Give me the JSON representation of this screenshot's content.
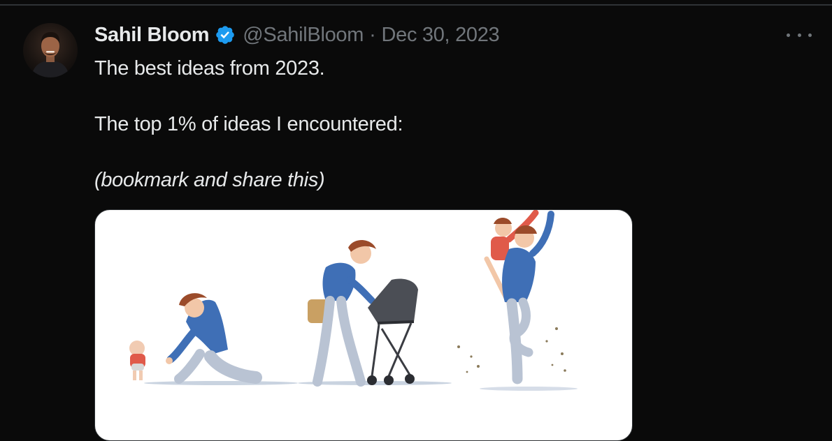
{
  "tweet": {
    "author_name": "Sahil Bloom",
    "handle": "@SahilBloom",
    "separator": "·",
    "date": "Dec 30, 2023",
    "verified": true,
    "lines": [
      "The best ideas from 2023.",
      "The top 1% of ideas I encountered:",
      "(bookmark and share this)"
    ],
    "media": {
      "description_icon": "illustration-image",
      "scenes": [
        "father-baby-first-steps",
        "father-pushing-stroller",
        "father-carrying-child"
      ]
    }
  },
  "colors": {
    "background": "#0a0a0a",
    "primary_text": "#e7e9ea",
    "secondary_text": "#71767b",
    "verified_blue": "#1d9bf0",
    "divider": "#2f3336"
  },
  "icons": {
    "verified": "verified-badge-icon",
    "more": "more-options-icon"
  }
}
